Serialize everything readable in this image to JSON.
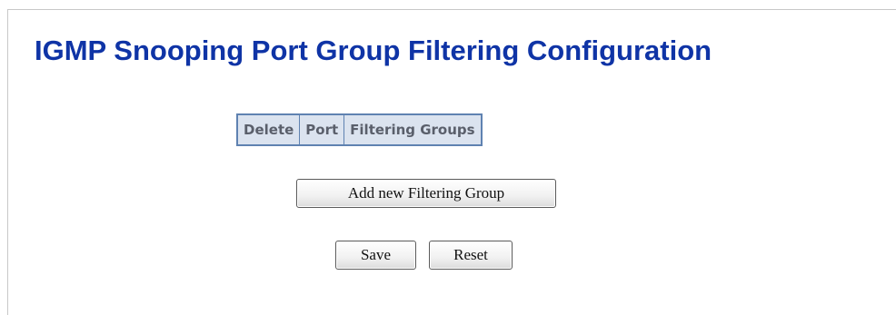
{
  "page": {
    "title": "IGMP Snooping Port Group Filtering Configuration"
  },
  "table": {
    "headers": [
      "Delete",
      "Port",
      "Filtering Groups"
    ],
    "rows": []
  },
  "buttons": {
    "add_label": "Add new Filtering Group",
    "save_label": "Save",
    "reset_label": "Reset"
  },
  "colors": {
    "title": "#0f34a6",
    "table_border": "#5f82b1",
    "table_header_bg": "#dbe3ef",
    "table_header_text": "#5a5f6b"
  }
}
